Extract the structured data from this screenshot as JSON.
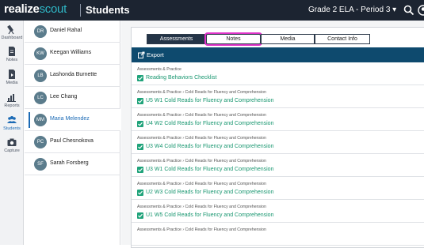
{
  "header": {
    "brand_part1": "realize",
    "brand_part2": "scout",
    "section": "Students",
    "class_select": "Grade 2 ELA - Period 3 ▾"
  },
  "nav": [
    {
      "label": "Dashboard",
      "icon": "telescope-icon"
    },
    {
      "label": "Notes",
      "icon": "notes-icon"
    },
    {
      "label": "Media",
      "icon": "media-icon"
    },
    {
      "label": "Reports",
      "icon": "reports-icon"
    },
    {
      "label": "Students",
      "icon": "students-icon"
    },
    {
      "label": "Capture",
      "icon": "camera-icon"
    }
  ],
  "students": [
    {
      "initials": "DR",
      "name": "Daniel Rahal"
    },
    {
      "initials": "KW",
      "name": "Keegan Williams"
    },
    {
      "initials": "LB",
      "name": "Lashonda Burnette"
    },
    {
      "initials": "LC",
      "name": "Lee Chang"
    },
    {
      "initials": "MM",
      "name": "Maria Melendez"
    },
    {
      "initials": "PC",
      "name": "Paul Chesnokova"
    },
    {
      "initials": "SF",
      "name": "Sarah Forsberg"
    }
  ],
  "tabs": [
    "Assessments",
    "Notes",
    "Media",
    "Contact Info"
  ],
  "export_label": "Export",
  "rows": [
    {
      "crumb": "Assessments & Practice",
      "title": "Reading Behaviors Checklist"
    },
    {
      "crumb": "Assessments & Practice › Cold Reads for Fluency and Comprehension",
      "title": "U5 W1 Cold Reads for Fluency and Comprehension"
    },
    {
      "crumb": "Assessments & Practice › Cold Reads for Fluency and Comprehension",
      "title": "U4 W2 Cold Reads for Fluency and Comprehension"
    },
    {
      "crumb": "Assessments & Practice › Cold Reads for Fluency and Comprehension",
      "title": "U3 W4 Cold Reads for Fluency and Comprehension"
    },
    {
      "crumb": "Assessments & Practice › Cold Reads for Fluency and Comprehension",
      "title": "U3 W1 Cold Reads for Fluency and Comprehension"
    },
    {
      "crumb": "Assessments & Practice › Cold Reads for Fluency and Comprehension",
      "title": "U2 W3 Cold Reads for Fluency and Comprehension"
    },
    {
      "crumb": "Assessments & Practice › Cold Reads for Fluency and Comprehension",
      "title": "U1 W5 Cold Reads for Fluency and Comprehension"
    },
    {
      "crumb": "Assessments & Practice › Cold Reads for Fluency and Comprehension",
      "title": ""
    }
  ],
  "colors": {
    "header_bg": "#1c2431",
    "brand_accent": "#2fb7c6",
    "export_bar": "#0e4a6e",
    "active_tab": "#243447",
    "highlight": "#e033c9",
    "title_green": "#17966f",
    "selected_blue": "#1b6ab5"
  }
}
